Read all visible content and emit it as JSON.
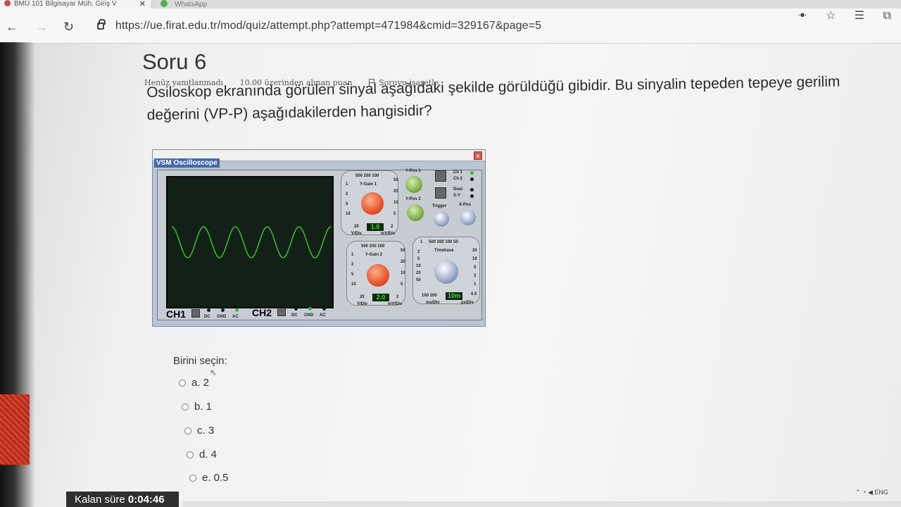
{
  "browser": {
    "tab_title": "BMÜ 101 Bilgisayar Müh. Giriş V",
    "tab2_title": "WhatsApp",
    "url": "https://ue.firat.edu.tr/mod/quiz/attempt.php?attempt=471984&cmid=329167&page=5"
  },
  "question": {
    "title": "Soru 6",
    "status": "Henüz yanıtlanmadı",
    "points": "10.00 üzerinden alınan puan",
    "flag_label": "Soruyu işaretle",
    "text": "Osiloskop ekranında görülen sinyal aşağıdaki şekilde görüldüğü gibidir. Bu sinyalin tepeden tepeye gerilim değerini (VP-P) aşağıdakilerden hangisidir?"
  },
  "oscilloscope": {
    "window_title": "VSM Oscilloscope",
    "ch1_label": "CH1",
    "ch2_label": "CH2",
    "coupling": [
      "DC",
      "GND",
      "AC"
    ],
    "ygain1": {
      "title": "Y-Gain 1",
      "top": "500 200 100",
      "left": [
        "1",
        "2",
        "5",
        "10"
      ],
      "right": [
        "50",
        "20",
        "10",
        "5"
      ],
      "bottom_left": "20",
      "bottom_right": "2",
      "value": "1.0",
      "unit_v": "V/Div",
      "unit_mv": "mV/Div"
    },
    "ygain2": {
      "title": "Y-Gain 2",
      "top": "500 200 100",
      "left": [
        "1",
        "2",
        "5",
        "10"
      ],
      "right": [
        "50",
        "20",
        "10",
        "5"
      ],
      "bottom_left": "20",
      "bottom_right": "2",
      "value": "2.0",
      "unit_v": "V/Div",
      "unit_mv": "mV/Div"
    },
    "timebase": {
      "title": "Timebase",
      "top": "500 200 100 50",
      "left": [
        "1",
        "2",
        "5",
        "10",
        "20",
        "50"
      ],
      "right": [
        "20",
        "10",
        "5",
        "2",
        "1",
        "0.5"
      ],
      "bottom_left": "100 200",
      "value": "10m",
      "unit_ms": "ms/Div",
      "unit_us": "µs/Div"
    },
    "ypos1": "Y-Pos 1",
    "ypos2": "Y-Pos 2",
    "trigger": "Trigger",
    "xpos": "X-Pos",
    "ch_switch": [
      "Ch 1",
      "Ch 2"
    ],
    "mode_switch": [
      "Dual",
      "X-Y"
    ]
  },
  "answers": {
    "prompt": "Birini seçin:",
    "options": [
      "a. 2",
      "b. 1",
      "c. 3",
      "d. 4",
      "e. 0.5"
    ]
  },
  "timer": {
    "label": "Kalan süre",
    "value": "0:04:46"
  },
  "tray": "ENG"
}
